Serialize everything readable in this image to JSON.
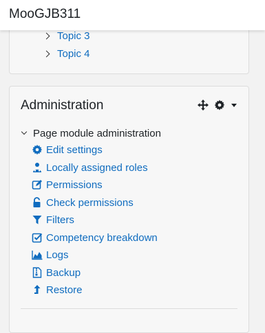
{
  "header": {
    "site_name": "MooGJB311"
  },
  "course_nav": {
    "topics": [
      {
        "label": "Topic 3"
      },
      {
        "label": "Topic 4"
      }
    ]
  },
  "administration": {
    "title": "Administration",
    "header_icons": [
      "move-icon",
      "gear-icon",
      "caret-down-icon"
    ],
    "section": {
      "title": "Page module administration",
      "items": [
        {
          "label": "Edit settings",
          "icon": "gear-icon"
        },
        {
          "label": "Locally assigned roles",
          "icon": "users-icon"
        },
        {
          "label": "Permissions",
          "icon": "pencil-square-icon"
        },
        {
          "label": "Check permissions",
          "icon": "unlock-icon"
        },
        {
          "label": "Filters",
          "icon": "filter-icon"
        },
        {
          "label": "Competency breakdown",
          "icon": "check-square-icon"
        },
        {
          "label": "Logs",
          "icon": "area-chart-icon"
        },
        {
          "label": "Backup",
          "icon": "file-archive-icon"
        },
        {
          "label": "Restore",
          "icon": "level-up-icon"
        }
      ]
    }
  },
  "colors": {
    "link": "#0f6cbf",
    "text": "#1d2125",
    "card_bg": "#f7f7f7",
    "page_bg": "#f2f2f2"
  }
}
